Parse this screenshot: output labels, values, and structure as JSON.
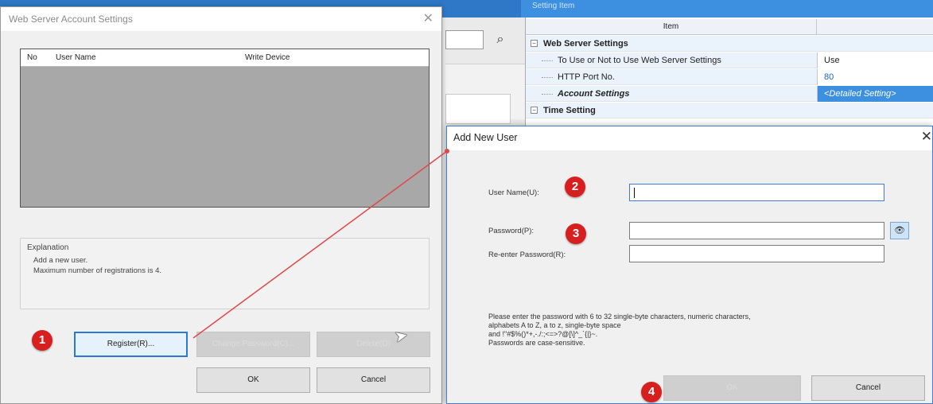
{
  "background": {
    "topbar_label": "Setting Item",
    "search_icon": "binoculars-icon",
    "grid": {
      "header": "Item",
      "rows": [
        {
          "name": "Web Server Settings",
          "value": "",
          "bold": true
        },
        {
          "name": "To Use or Not to Use Web Server Settings",
          "value": "Use"
        },
        {
          "name": "HTTP Port No.",
          "value": "80"
        },
        {
          "name": "Account Settings",
          "value": "<Detailed Setting>"
        },
        {
          "name": "Time Setting",
          "value": "",
          "bold": true
        }
      ]
    }
  },
  "account_dialog": {
    "title": "Web Server Account Settings",
    "close_glyph": "✕",
    "columns": [
      "No",
      "User Name",
      "Write Device"
    ],
    "explanation_label": "Explanation",
    "explanation_lines": [
      "Add a new user.",
      "Maximum number of registrations is 4."
    ],
    "buttons": {
      "register": "Register(R)...",
      "change": "Change Password(C)...",
      "delete": "Delete(D)",
      "ok": "OK",
      "cancel": "Cancel"
    }
  },
  "add_user_dialog": {
    "title": "Add New User",
    "close_glyph": "✕",
    "user_name_label": "User Name(U):",
    "user_name_value": "",
    "password_label": "Password(P):",
    "password_value": "",
    "reenter_label": "Re-enter Password(R):",
    "reenter_value": "",
    "eye_glyph": "👁",
    "notes": [
      "Please enter the password with 6 to 32 single-byte characters, numeric characters,",
      "alphabets A to Z, a to z, single-byte space",
      "and !\"#$%()*+,-./:;<=>?@[\\]^_`{|}~.",
      "Passwords are case-sensitive."
    ],
    "buttons": {
      "ok": "OK",
      "cancel": "Cancel"
    }
  },
  "markers": [
    "1",
    "2",
    "3",
    "4"
  ],
  "colors": {
    "marker": "#d71f1f",
    "accent": "#3d8fe0",
    "arrow": "#e04848"
  }
}
